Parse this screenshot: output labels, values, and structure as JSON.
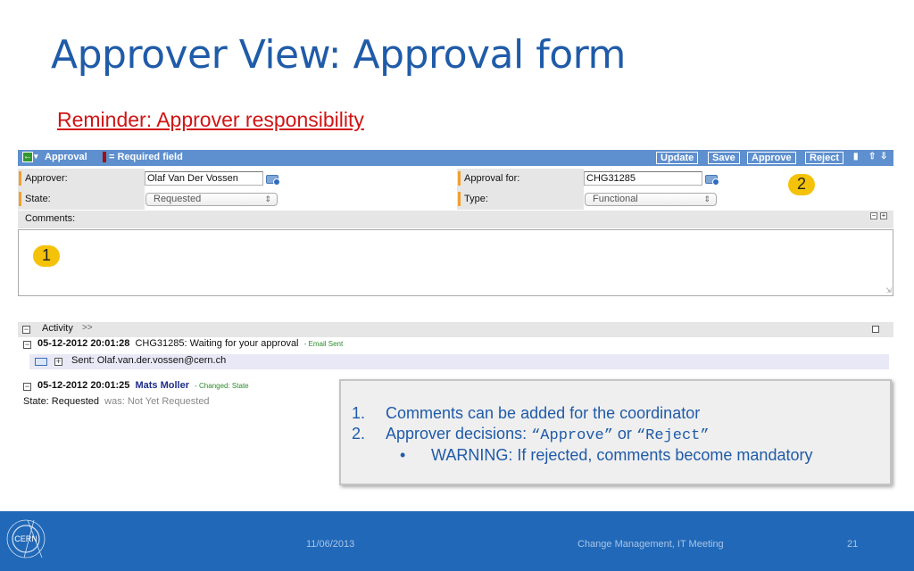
{
  "slide": {
    "title": "Approver View: Approval form",
    "subtitle": "Reminder: Approver responsibility"
  },
  "form": {
    "header": {
      "title": "Approval",
      "required_legend": "= Required field",
      "buttons": {
        "update": "Update",
        "save": "Save",
        "approve": "Approve",
        "reject": "Reject"
      }
    },
    "fields": {
      "approver_label": "Approver:",
      "approver_value": "Olaf Van Der Vossen",
      "approval_for_label": "Approval for:",
      "approval_for_value": "CHG31285",
      "state_label": "State:",
      "state_value": "Requested",
      "type_label": "Type:",
      "type_value": "Functional"
    },
    "comments_label": "Comments:"
  },
  "badges": {
    "one": "1",
    "two": "2"
  },
  "activity": {
    "label": "Activity",
    "chevron": ">>",
    "entries": [
      {
        "datetime": "05-12-2012 20:01:28",
        "text": "CHG31285: Waiting for your approval",
        "tag": "- Email Sent"
      },
      {
        "datetime": "05-12-2012 20:01:25",
        "user": "Mats Moller",
        "tag": "- Changed:  State"
      }
    ],
    "sent_line": "Sent: Olaf.van.der.vossen@cern.ch",
    "state_line_value": "State: Requested",
    "state_line_was": "was: Not Yet Requested"
  },
  "callout": {
    "item1_num": "1.",
    "item1": "Comments can be added for the coordinator",
    "item2_num": "2.",
    "item2_prefix": "Approver decisions: ",
    "item2_approve": "“Approve”",
    "item2_or": " or ",
    "item2_reject": "“Reject”",
    "bullet": "•",
    "bullet_text": "WARNING: If rejected, comments become mandatory"
  },
  "footer": {
    "logo_text": "CERN",
    "date": "11/06/2013",
    "event": "Change Management, IT Meeting",
    "page": "21"
  },
  "colors": {
    "title_blue": "#1f5ba8",
    "subtitle_red": "#d01515",
    "header_blue": "#5e8fce",
    "footer_blue": "#2169b8",
    "badge_yellow": "#f5c20a"
  }
}
